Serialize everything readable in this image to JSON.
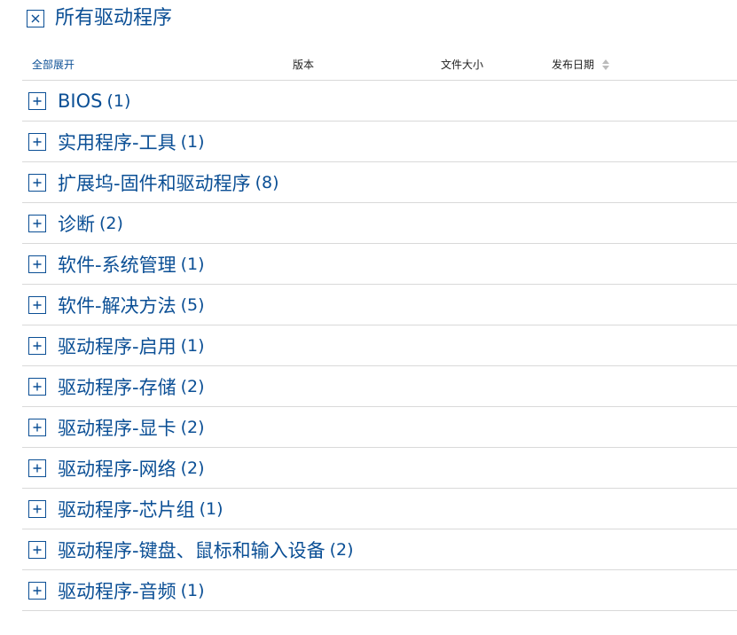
{
  "header": {
    "title": "所有驱动程序",
    "close_icon": "close-icon"
  },
  "columns": {
    "expand_all": "全部展开",
    "version": "版本",
    "file_size": "文件大小",
    "release_date": "发布日期",
    "sort_icon": "sort-icon"
  },
  "categories": [
    {
      "label": "BIOS",
      "count": "(1)"
    },
    {
      "label": "实用程序-工具",
      "count": "(1)"
    },
    {
      "label": "扩展坞-固件和驱动程序",
      "count": "(8)"
    },
    {
      "label": "诊断",
      "count": "(2)"
    },
    {
      "label": "软件-系统管理",
      "count": "(1)"
    },
    {
      "label": "软件-解决方法",
      "count": "(5)"
    },
    {
      "label": "驱动程序-启用",
      "count": "(1)"
    },
    {
      "label": "驱动程序-存储",
      "count": "(2)"
    },
    {
      "label": "驱动程序-显卡",
      "count": "(2)"
    },
    {
      "label": "驱动程序-网络",
      "count": "(2)"
    },
    {
      "label": "驱动程序-芯片组",
      "count": "(1)"
    },
    {
      "label": "驱动程序-键盘、鼠标和输入设备",
      "count": "(2)"
    },
    {
      "label": "驱动程序-音频",
      "count": "(1)"
    }
  ],
  "colors": {
    "accent": "#0b4f95",
    "divider": "#d9d9d9"
  }
}
